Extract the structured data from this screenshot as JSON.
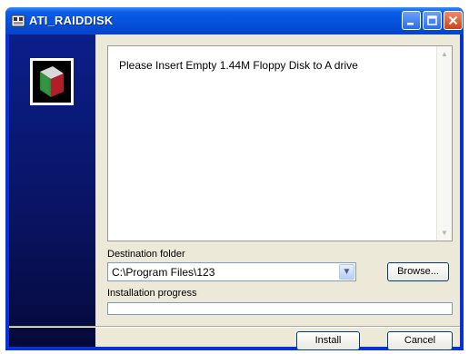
{
  "window": {
    "title": "ATI_RAIDDISK"
  },
  "content": {
    "message": "Please Insert Empty 1.44M Floppy Disk to A drive"
  },
  "destination": {
    "label": "Destination folder",
    "value": "C:\\Program Files\\123",
    "browse_label": "Browse..."
  },
  "progress": {
    "label": "Installation progress",
    "value": 0
  },
  "buttons": {
    "install": "Install",
    "cancel": "Cancel"
  },
  "icons": {
    "titlebar": "installer-app-icon",
    "panel": "disk-logo-icon",
    "dropdown": "chevron-down-icon"
  },
  "colors": {
    "titlebar": "#0552dd",
    "sidepanel": "#0a1465",
    "dialog_bg": "#ece9d8",
    "close_button": "#d13f16"
  }
}
